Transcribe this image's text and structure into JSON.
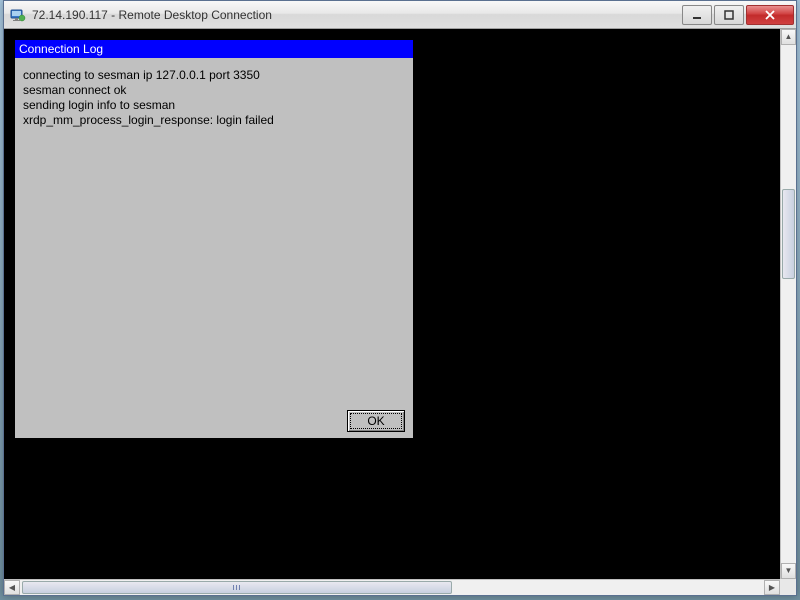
{
  "window": {
    "title": "72.14.190.117 - Remote Desktop Connection"
  },
  "dialog": {
    "title": "Connection Log",
    "log_lines": [
      "connecting to sesman ip 127.0.0.1 port 3350",
      "sesman connect ok",
      "sending login info to sesman",
      "xrdp_mm_process_login_response: login failed"
    ],
    "ok_label": "OK"
  }
}
